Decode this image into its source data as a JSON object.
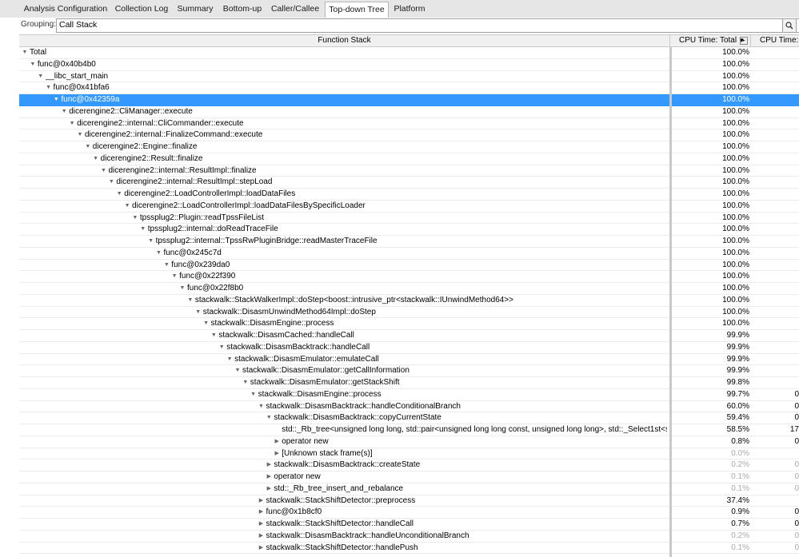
{
  "tabs": [
    {
      "label": "Analysis Configuration",
      "active": false
    },
    {
      "label": "Collection Log",
      "active": false
    },
    {
      "label": "Summary",
      "active": false
    },
    {
      "label": "Bottom-up",
      "active": false
    },
    {
      "label": "Caller/Callee",
      "active": false
    },
    {
      "label": "Top-down Tree",
      "active": true
    },
    {
      "label": "Platform",
      "active": false
    }
  ],
  "grouping": {
    "label": "Grouping:",
    "value": "Call Stack"
  },
  "columns": {
    "function_stack": "Function Stack",
    "cpu_total": "CPU Time: Total",
    "cpu_self": "CPU Time: S"
  },
  "colors": {
    "selection": "#3399ff",
    "tab_bg": "#e6e6e6",
    "header_bg": "#f0f0f0"
  },
  "rows": [
    {
      "name": "Total",
      "depth": 0,
      "tri": "down",
      "total": "100.0%",
      "self": ""
    },
    {
      "name": "func@0x40b4b0",
      "depth": 1,
      "tri": "down",
      "total": "100.0%",
      "self": ""
    },
    {
      "name": "__libc_start_main",
      "depth": 2,
      "tri": "down",
      "total": "100.0%",
      "self": ""
    },
    {
      "name": "func@0x41bfa6",
      "depth": 3,
      "tri": "down",
      "total": "100.0%",
      "self": ""
    },
    {
      "name": "func@0x42359a",
      "depth": 4,
      "tri": "down",
      "total": "100.0%",
      "self": "",
      "selected": true
    },
    {
      "name": "dicerengine2::CliManager::execute",
      "depth": 5,
      "tri": "down",
      "total": "100.0%",
      "self": ""
    },
    {
      "name": "dicerengine2::internal::CliCommander::execute",
      "depth": 6,
      "tri": "down",
      "total": "100.0%",
      "self": ""
    },
    {
      "name": "dicerengine2::internal::FinalizeCommand::execute",
      "depth": 7,
      "tri": "down",
      "total": "100.0%",
      "self": ""
    },
    {
      "name": "dicerengine2::Engine::finalize",
      "depth": 8,
      "tri": "down",
      "total": "100.0%",
      "self": ""
    },
    {
      "name": "dicerengine2::Result::finalize",
      "depth": 9,
      "tri": "down",
      "total": "100.0%",
      "self": ""
    },
    {
      "name": "dicerengine2::internal::ResultImpl::finalize",
      "depth": 10,
      "tri": "down",
      "total": "100.0%",
      "self": ""
    },
    {
      "name": "dicerengine2::internal::ResultImpl::stepLoad",
      "depth": 11,
      "tri": "down",
      "total": "100.0%",
      "self": ""
    },
    {
      "name": "dicerengine2::LoadControllerImpl::loadDataFiles",
      "depth": 12,
      "tri": "down",
      "total": "100.0%",
      "self": ""
    },
    {
      "name": "dicerengine2::LoadControllerImpl::loadDataFilesBySpecificLoader",
      "depth": 13,
      "tri": "down",
      "total": "100.0%",
      "self": ""
    },
    {
      "name": "tpssplug2::Plugin::readTpssFileList",
      "depth": 14,
      "tri": "down",
      "total": "100.0%",
      "self": ""
    },
    {
      "name": "tpssplug2::internal::doReadTraceFile",
      "depth": 15,
      "tri": "down",
      "total": "100.0%",
      "self": ""
    },
    {
      "name": "tpssplug2::internal::TpssRwPluginBridge::readMasterTraceFile",
      "depth": 16,
      "tri": "down",
      "total": "100.0%",
      "self": ""
    },
    {
      "name": "func@0x245c7d",
      "depth": 17,
      "tri": "down",
      "total": "100.0%",
      "self": ""
    },
    {
      "name": "func@0x239da0",
      "depth": 18,
      "tri": "down",
      "total": "100.0%",
      "self": ""
    },
    {
      "name": "func@0x22f390",
      "depth": 19,
      "tri": "down",
      "total": "100.0%",
      "self": ""
    },
    {
      "name": "func@0x22f8b0",
      "depth": 20,
      "tri": "down",
      "total": "100.0%",
      "self": ""
    },
    {
      "name": "stackwalk::StackWalkerImpl::doStep<boost::intrusive_ptr<stackwalk::IUnwindMethod64>>",
      "depth": 21,
      "tri": "down",
      "total": "100.0%",
      "self": ""
    },
    {
      "name": "stackwalk::DisasmUnwindMethod64Impl::doStep",
      "depth": 22,
      "tri": "down",
      "total": "100.0%",
      "self": ""
    },
    {
      "name": "stackwalk::DisasmEngine::process",
      "depth": 23,
      "tri": "down",
      "total": "100.0%",
      "self": ""
    },
    {
      "name": "stackwalk::DisasmCached::handleCall",
      "depth": 24,
      "tri": "down",
      "total": "99.9%",
      "self": ""
    },
    {
      "name": "stackwalk::DisasmBacktrack::handleCall",
      "depth": 25,
      "tri": "down",
      "total": "99.9%",
      "self": ""
    },
    {
      "name": "stackwalk::DisasmEmulator::emulateCall",
      "depth": 26,
      "tri": "down",
      "total": "99.9%",
      "self": ""
    },
    {
      "name": "stackwalk::DisasmEmulator::getCallInformation",
      "depth": 27,
      "tri": "down",
      "total": "99.9%",
      "self": ""
    },
    {
      "name": "stackwalk::DisasmEmulator::getStackShift",
      "depth": 28,
      "tri": "down",
      "total": "99.8%",
      "self": ""
    },
    {
      "name": "stackwalk::DisasmEngine::process",
      "depth": 29,
      "tri": "down",
      "total": "99.7%",
      "self": "0"
    },
    {
      "name": "stackwalk::DisasmBacktrack::handleConditionalBranch",
      "depth": 30,
      "tri": "down",
      "total": "60.0%",
      "self": "0"
    },
    {
      "name": "stackwalk::DisasmBacktrack::copyCurrentState",
      "depth": 31,
      "tri": "down",
      "total": "59.4%",
      "self": "0"
    },
    {
      "name": "std::_Rb_tree<unsigned long long, std::pair<unsigned long long const, unsigned long long>, std::_Select1st<std::pair<unsigned long long const",
      "depth": 32,
      "tri": "none",
      "total": "58.5%",
      "self": "17"
    },
    {
      "name": "operator new",
      "depth": 32,
      "tri": "right",
      "total": "0.8%",
      "self": "0"
    },
    {
      "name": "[Unknown stack frame(s)]",
      "depth": 32,
      "tri": "right",
      "total": "0.0%",
      "self": "",
      "dim": true
    },
    {
      "name": "stackwalk::DisasmBacktrack::createState",
      "depth": 31,
      "tri": "right",
      "total": "0.2%",
      "self": "0",
      "dim": true
    },
    {
      "name": "operator new",
      "depth": 31,
      "tri": "right",
      "total": "0.1%",
      "self": "0",
      "dim": true
    },
    {
      "name": "std::_Rb_tree_insert_and_rebalance",
      "depth": 31,
      "tri": "right",
      "total": "0.1%",
      "self": "0",
      "dim": true
    },
    {
      "name": "stackwalk::StackShiftDetector::preprocess",
      "depth": 30,
      "tri": "right",
      "total": "37.4%",
      "self": ""
    },
    {
      "name": "func@0x1b8cf0",
      "depth": 30,
      "tri": "right",
      "total": "0.9%",
      "self": "0"
    },
    {
      "name": "stackwalk::StackShiftDetector::handleCall",
      "depth": 30,
      "tri": "right",
      "total": "0.7%",
      "self": "0"
    },
    {
      "name": "stackwalk::DisasmBacktrack::handleUnconditionalBranch",
      "depth": 30,
      "tri": "right",
      "total": "0.2%",
      "self": "0",
      "dim": true
    },
    {
      "name": "stackwalk::StackShiftDetector::handlePush",
      "depth": 30,
      "tri": "right",
      "total": "0.1%",
      "self": "0",
      "dim": true
    }
  ]
}
